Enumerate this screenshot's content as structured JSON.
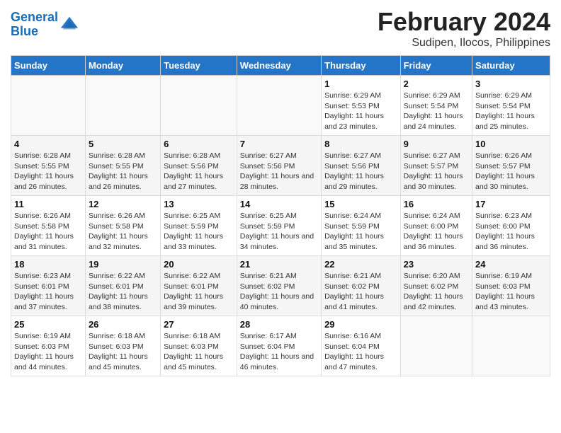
{
  "header": {
    "logo_line1": "General",
    "logo_line2": "Blue",
    "month": "February 2024",
    "location": "Sudipen, Ilocos, Philippines"
  },
  "weekdays": [
    "Sunday",
    "Monday",
    "Tuesday",
    "Wednesday",
    "Thursday",
    "Friday",
    "Saturday"
  ],
  "weeks": [
    [
      {
        "day": "",
        "info": ""
      },
      {
        "day": "",
        "info": ""
      },
      {
        "day": "",
        "info": ""
      },
      {
        "day": "",
        "info": ""
      },
      {
        "day": "1",
        "info": "Sunrise: 6:29 AM\nSunset: 5:53 PM\nDaylight: 11 hours and 23 minutes."
      },
      {
        "day": "2",
        "info": "Sunrise: 6:29 AM\nSunset: 5:54 PM\nDaylight: 11 hours and 24 minutes."
      },
      {
        "day": "3",
        "info": "Sunrise: 6:29 AM\nSunset: 5:54 PM\nDaylight: 11 hours and 25 minutes."
      }
    ],
    [
      {
        "day": "4",
        "info": "Sunrise: 6:28 AM\nSunset: 5:55 PM\nDaylight: 11 hours and 26 minutes."
      },
      {
        "day": "5",
        "info": "Sunrise: 6:28 AM\nSunset: 5:55 PM\nDaylight: 11 hours and 26 minutes."
      },
      {
        "day": "6",
        "info": "Sunrise: 6:28 AM\nSunset: 5:56 PM\nDaylight: 11 hours and 27 minutes."
      },
      {
        "day": "7",
        "info": "Sunrise: 6:27 AM\nSunset: 5:56 PM\nDaylight: 11 hours and 28 minutes."
      },
      {
        "day": "8",
        "info": "Sunrise: 6:27 AM\nSunset: 5:56 PM\nDaylight: 11 hours and 29 minutes."
      },
      {
        "day": "9",
        "info": "Sunrise: 6:27 AM\nSunset: 5:57 PM\nDaylight: 11 hours and 30 minutes."
      },
      {
        "day": "10",
        "info": "Sunrise: 6:26 AM\nSunset: 5:57 PM\nDaylight: 11 hours and 30 minutes."
      }
    ],
    [
      {
        "day": "11",
        "info": "Sunrise: 6:26 AM\nSunset: 5:58 PM\nDaylight: 11 hours and 31 minutes."
      },
      {
        "day": "12",
        "info": "Sunrise: 6:26 AM\nSunset: 5:58 PM\nDaylight: 11 hours and 32 minutes."
      },
      {
        "day": "13",
        "info": "Sunrise: 6:25 AM\nSunset: 5:59 PM\nDaylight: 11 hours and 33 minutes."
      },
      {
        "day": "14",
        "info": "Sunrise: 6:25 AM\nSunset: 5:59 PM\nDaylight: 11 hours and 34 minutes."
      },
      {
        "day": "15",
        "info": "Sunrise: 6:24 AM\nSunset: 5:59 PM\nDaylight: 11 hours and 35 minutes."
      },
      {
        "day": "16",
        "info": "Sunrise: 6:24 AM\nSunset: 6:00 PM\nDaylight: 11 hours and 36 minutes."
      },
      {
        "day": "17",
        "info": "Sunrise: 6:23 AM\nSunset: 6:00 PM\nDaylight: 11 hours and 36 minutes."
      }
    ],
    [
      {
        "day": "18",
        "info": "Sunrise: 6:23 AM\nSunset: 6:01 PM\nDaylight: 11 hours and 37 minutes."
      },
      {
        "day": "19",
        "info": "Sunrise: 6:22 AM\nSunset: 6:01 PM\nDaylight: 11 hours and 38 minutes."
      },
      {
        "day": "20",
        "info": "Sunrise: 6:22 AM\nSunset: 6:01 PM\nDaylight: 11 hours and 39 minutes."
      },
      {
        "day": "21",
        "info": "Sunrise: 6:21 AM\nSunset: 6:02 PM\nDaylight: 11 hours and 40 minutes."
      },
      {
        "day": "22",
        "info": "Sunrise: 6:21 AM\nSunset: 6:02 PM\nDaylight: 11 hours and 41 minutes."
      },
      {
        "day": "23",
        "info": "Sunrise: 6:20 AM\nSunset: 6:02 PM\nDaylight: 11 hours and 42 minutes."
      },
      {
        "day": "24",
        "info": "Sunrise: 6:19 AM\nSunset: 6:03 PM\nDaylight: 11 hours and 43 minutes."
      }
    ],
    [
      {
        "day": "25",
        "info": "Sunrise: 6:19 AM\nSunset: 6:03 PM\nDaylight: 11 hours and 44 minutes."
      },
      {
        "day": "26",
        "info": "Sunrise: 6:18 AM\nSunset: 6:03 PM\nDaylight: 11 hours and 45 minutes."
      },
      {
        "day": "27",
        "info": "Sunrise: 6:18 AM\nSunset: 6:03 PM\nDaylight: 11 hours and 45 minutes."
      },
      {
        "day": "28",
        "info": "Sunrise: 6:17 AM\nSunset: 6:04 PM\nDaylight: 11 hours and 46 minutes."
      },
      {
        "day": "29",
        "info": "Sunrise: 6:16 AM\nSunset: 6:04 PM\nDaylight: 11 hours and 47 minutes."
      },
      {
        "day": "",
        "info": ""
      },
      {
        "day": "",
        "info": ""
      }
    ]
  ]
}
